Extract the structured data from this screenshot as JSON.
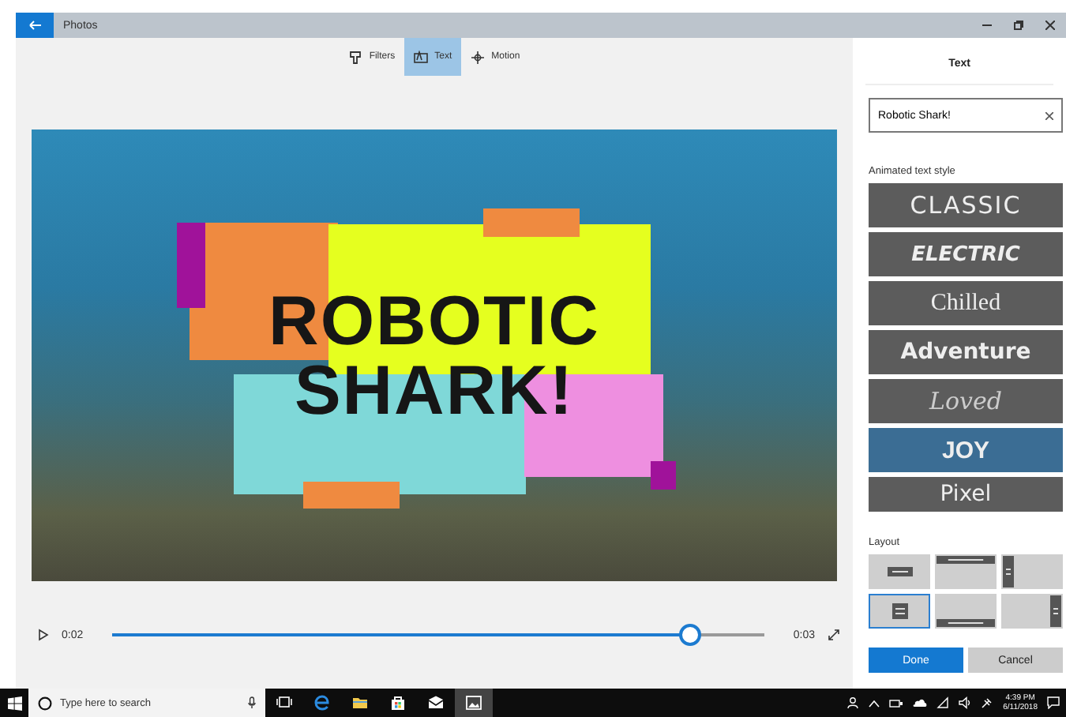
{
  "window": {
    "title": "Photos"
  },
  "toolbar": [
    {
      "label": "Filters",
      "kind": "filters",
      "selected": false
    },
    {
      "label": "Text",
      "kind": "text",
      "selected": true
    },
    {
      "label": "Motion",
      "kind": "motion",
      "selected": false
    }
  ],
  "video": {
    "overlay_lines": [
      "ROBOTIC",
      "SHARK!"
    ]
  },
  "playback": {
    "current": "0:02",
    "end": "0:03",
    "level": 0.9
  },
  "panel": {
    "title": "Text",
    "text_field": {
      "value": "Robotic Shark!"
    },
    "styles_label": "Animated text style",
    "styles": [
      {
        "label": "CLASSIC",
        "kind": "classic",
        "selected": false
      },
      {
        "label": "ELECTRIC",
        "kind": "electric",
        "selected": false
      },
      {
        "label": "Chilled",
        "kind": "chilled",
        "selected": false
      },
      {
        "label": "Adventure",
        "kind": "adventure",
        "selected": false
      },
      {
        "label": "Loved",
        "kind": "loved",
        "selected": false
      },
      {
        "label": "JOY",
        "kind": "joy",
        "selected": true
      },
      {
        "label": "Pixel",
        "kind": "pixel",
        "selected": false
      }
    ],
    "layout_label": "Layout",
    "layouts": [
      {
        "kind": "center",
        "selected": false
      },
      {
        "kind": "top",
        "selected": false
      },
      {
        "kind": "left",
        "selected": false
      },
      {
        "kind": "center-stack",
        "selected": true
      },
      {
        "kind": "bottom",
        "selected": false
      },
      {
        "kind": "right",
        "selected": false
      }
    ],
    "buttons": [
      {
        "label": "Done",
        "kind": "primary"
      },
      {
        "label": "Cancel",
        "kind": "secondary"
      }
    ]
  },
  "taskbar": {
    "search_placeholder": "Type here to search",
    "apps": [
      {
        "kind": "task-view",
        "selected": false
      },
      {
        "kind": "browser",
        "selected": false
      },
      {
        "kind": "folder",
        "selected": false
      },
      {
        "kind": "store",
        "selected": false
      },
      {
        "kind": "mail",
        "selected": false
      },
      {
        "kind": "photos",
        "selected": true
      }
    ],
    "time": "4:39 PM",
    "date": "6/11/2018"
  }
}
